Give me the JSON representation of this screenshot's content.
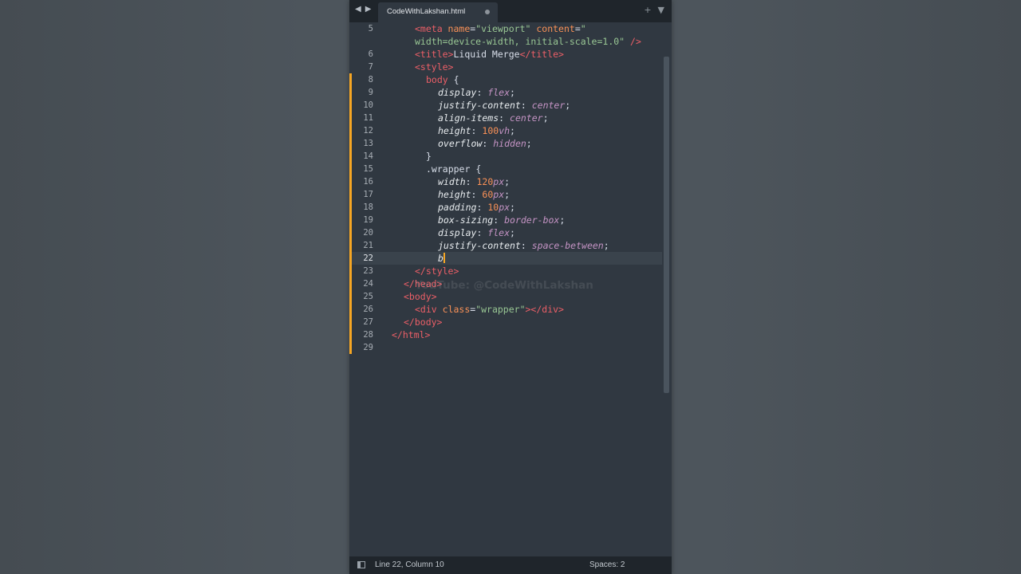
{
  "window": {
    "tab_title": "CodeWithLakshan.html",
    "nav_back": "◀",
    "nav_forward": "▶",
    "new_tab": "+",
    "tab_menu": "▼"
  },
  "watermark": "YouTube: @CodeWithLakshan",
  "status": {
    "position": "Line 22, Column 10",
    "indentation": "Spaces: 2"
  },
  "editor": {
    "current_line": 22,
    "lines": [
      {
        "num": "5",
        "tokens": [
          {
            "c": "tg",
            "t": "<meta "
          },
          {
            "c": "at",
            "t": "name"
          },
          {
            "c": "pu",
            "t": "="
          },
          {
            "c": "st",
            "t": "\"viewport\" "
          },
          {
            "c": "at",
            "t": "content"
          },
          {
            "c": "pu",
            "t": "="
          },
          {
            "c": "st",
            "t": "\""
          }
        ]
      },
      {
        "num": "",
        "tokens": [
          {
            "c": "st",
            "t": "width=device-width, initial-scale=1.0\" "
          },
          {
            "c": "tg",
            "t": "/>"
          }
        ]
      },
      {
        "num": "6",
        "tokens": [
          {
            "c": "tg",
            "t": "<title>"
          },
          {
            "c": "cl",
            "t": "Liquid Merge"
          },
          {
            "c": "tg",
            "t": "</title>"
          }
        ]
      },
      {
        "num": "7",
        "tokens": [
          {
            "c": "tg",
            "t": "<style>"
          }
        ]
      },
      {
        "num": "8",
        "tokens": [
          {
            "c": "tg",
            "t": "body "
          },
          {
            "c": "pu",
            "t": "{"
          }
        ]
      },
      {
        "num": "9",
        "tokens": [
          {
            "c": "pr",
            "t": "display"
          },
          {
            "c": "pu",
            "t": ": "
          },
          {
            "c": "vl",
            "t": "flex"
          },
          {
            "c": "pu",
            "t": ";"
          }
        ]
      },
      {
        "num": "10",
        "tokens": [
          {
            "c": "pr",
            "t": "justify-content"
          },
          {
            "c": "pu",
            "t": ": "
          },
          {
            "c": "vl",
            "t": "center"
          },
          {
            "c": "pu",
            "t": ";"
          }
        ]
      },
      {
        "num": "11",
        "tokens": [
          {
            "c": "pr",
            "t": "align-items"
          },
          {
            "c": "pu",
            "t": ": "
          },
          {
            "c": "vl",
            "t": "center"
          },
          {
            "c": "pu",
            "t": ";"
          }
        ]
      },
      {
        "num": "12",
        "tokens": [
          {
            "c": "pr",
            "t": "height"
          },
          {
            "c": "pu",
            "t": ": "
          },
          {
            "c": "nu",
            "t": "100"
          },
          {
            "c": "un",
            "t": "vh"
          },
          {
            "c": "pu",
            "t": ";"
          }
        ]
      },
      {
        "num": "13",
        "tokens": [
          {
            "c": "pr",
            "t": "overflow"
          },
          {
            "c": "pu",
            "t": ": "
          },
          {
            "c": "vl",
            "t": "hidden"
          },
          {
            "c": "pu",
            "t": ";"
          }
        ]
      },
      {
        "num": "14",
        "tokens": [
          {
            "c": "pu",
            "t": "}"
          }
        ]
      },
      {
        "num": "15",
        "tokens": [
          {
            "c": "cl",
            "t": ".wrapper "
          },
          {
            "c": "pu",
            "t": "{"
          }
        ]
      },
      {
        "num": "16",
        "tokens": [
          {
            "c": "pr",
            "t": "width"
          },
          {
            "c": "pu",
            "t": ": "
          },
          {
            "c": "nu",
            "t": "120"
          },
          {
            "c": "un",
            "t": "px"
          },
          {
            "c": "pu",
            "t": ";"
          }
        ]
      },
      {
        "num": "17",
        "tokens": [
          {
            "c": "pr",
            "t": "height"
          },
          {
            "c": "pu",
            "t": ": "
          },
          {
            "c": "nu",
            "t": "60"
          },
          {
            "c": "un",
            "t": "px"
          },
          {
            "c": "pu",
            "t": ";"
          }
        ]
      },
      {
        "num": "18",
        "tokens": [
          {
            "c": "pr",
            "t": "padding"
          },
          {
            "c": "pu",
            "t": ": "
          },
          {
            "c": "nu",
            "t": "10"
          },
          {
            "c": "un",
            "t": "px"
          },
          {
            "c": "pu",
            "t": ";"
          }
        ]
      },
      {
        "num": "19",
        "tokens": [
          {
            "c": "pr",
            "t": "box-sizing"
          },
          {
            "c": "pu",
            "t": ": "
          },
          {
            "c": "vl",
            "t": "border-box"
          },
          {
            "c": "pu",
            "t": ";"
          }
        ]
      },
      {
        "num": "20",
        "tokens": [
          {
            "c": "pr",
            "t": "display"
          },
          {
            "c": "pu",
            "t": ": "
          },
          {
            "c": "vl",
            "t": "flex"
          },
          {
            "c": "pu",
            "t": ";"
          }
        ]
      },
      {
        "num": "21",
        "tokens": [
          {
            "c": "pr",
            "t": "justify-content"
          },
          {
            "c": "pu",
            "t": ": "
          },
          {
            "c": "vl",
            "t": "space-between"
          },
          {
            "c": "pu",
            "t": ";"
          }
        ]
      },
      {
        "num": "22",
        "tokens": [
          {
            "c": "pr",
            "t": "b"
          }
        ]
      },
      {
        "num": "23",
        "tokens": [
          {
            "c": "tg",
            "t": "</style>"
          }
        ]
      },
      {
        "num": "24",
        "tokens": [
          {
            "c": "tg",
            "t": "</head>"
          }
        ]
      },
      {
        "num": "25",
        "tokens": [
          {
            "c": "tg",
            "t": "<body>"
          }
        ]
      },
      {
        "num": "26",
        "tokens": [
          {
            "c": "tg",
            "t": "<div "
          },
          {
            "c": "at",
            "t": "class"
          },
          {
            "c": "pu",
            "t": "="
          },
          {
            "c": "st",
            "t": "\"wrapper\""
          },
          {
            "c": "tg",
            "t": "></div>"
          }
        ]
      },
      {
        "num": "27",
        "tokens": [
          {
            "c": "tg",
            "t": "</body>"
          }
        ]
      },
      {
        "num": "28",
        "tokens": [
          {
            "c": "tg",
            "t": "</html>"
          }
        ]
      },
      {
        "num": "29",
        "tokens": []
      }
    ]
  }
}
